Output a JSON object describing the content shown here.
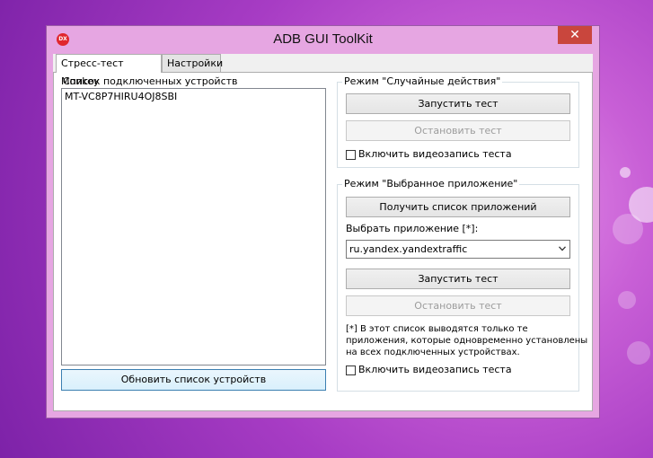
{
  "window": {
    "title": "ADB GUI ToolKit",
    "icon_text": "DX",
    "close_label": "✕"
  },
  "tabs": [
    {
      "label": "Стресс-тест Monkey",
      "active": true
    },
    {
      "label": "Настройки",
      "active": false
    }
  ],
  "devices": {
    "group_label": "Список подключенных устройств",
    "items": [
      "MT-VC8P7HIRU4OJ8SBI"
    ],
    "refresh_button": "Обновить список устройств"
  },
  "random_mode": {
    "group_label": "Режим \"Случайные действия\"",
    "start_button": "Запустить тест",
    "stop_button": "Остановить тест",
    "video_checkbox": "Включить видеозапись теста",
    "video_checked": false
  },
  "app_mode": {
    "group_label": "Режим \"Выбранное приложение\"",
    "get_apps_button": "Получить список приложений",
    "select_label": "Выбрать приложение [*]:",
    "selected_app": "ru.yandex.yandextraffic",
    "start_button": "Запустить тест",
    "stop_button": "Остановить тест",
    "note_line1": "[*] В этот список выводятся только те",
    "note_line2": "приложения, которые одновременно установлены",
    "note_line3": "на всех подключенных устройствах.",
    "video_checkbox": "Включить видеозапись теста",
    "video_checked": false
  },
  "colors": {
    "close_button": "#c9463d",
    "window_frame": "#e6a6e2",
    "focus_border": "#3c7fb1"
  }
}
